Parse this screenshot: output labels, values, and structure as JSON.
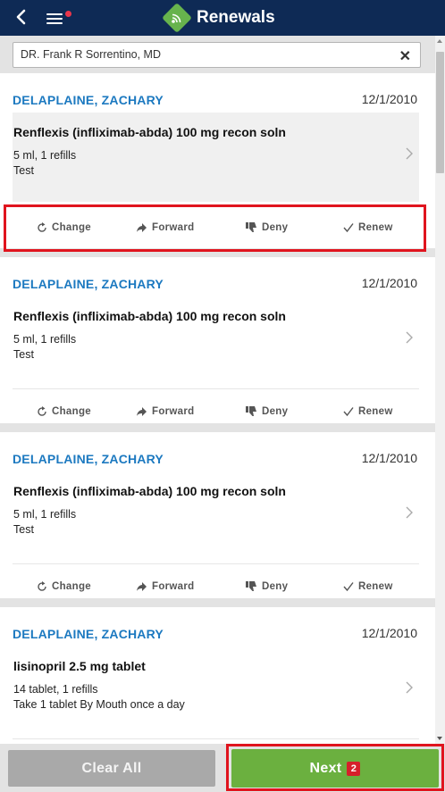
{
  "header": {
    "title": "Renewals",
    "menu_has_notification": true
  },
  "filter": {
    "value": "DR. Frank R Sorrentino, MD",
    "clear_glyph": "✕"
  },
  "actions": {
    "change": "Change",
    "forward": "Forward",
    "deny": "Deny",
    "renew": "Renew"
  },
  "cards": [
    {
      "patient": "DELAPLAINE, ZACHARY",
      "date": "12/1/2010",
      "drug": "Renflexis (infliximab-abda) 100 mg recon soln",
      "qty": "5 ml, 1 refills",
      "note": "Test",
      "selected": true
    },
    {
      "patient": "DELAPLAINE, ZACHARY",
      "date": "12/1/2010",
      "drug": "Renflexis (infliximab-abda) 100 mg recon soln",
      "qty": "5 ml, 1 refills",
      "note": "Test",
      "selected": false
    },
    {
      "patient": "DELAPLAINE, ZACHARY",
      "date": "12/1/2010",
      "drug": "Renflexis (infliximab-abda) 100 mg recon soln",
      "qty": "5 ml, 1 refills",
      "note": "Test",
      "selected": false
    },
    {
      "patient": "DELAPLAINE, ZACHARY",
      "date": "12/1/2010",
      "drug": "lisinopril 2.5 mg tablet",
      "qty": "14 tablet, 1 refills",
      "note": "Take 1 tablet By Mouth once a day",
      "selected": false
    }
  ],
  "footer": {
    "clear_all": "Clear All",
    "next": "Next",
    "next_count": "2"
  },
  "colors": {
    "header_bg": "#0e2a55",
    "accent_blue": "#1c79c0",
    "brand_green": "#67b34d",
    "next_green": "#6bb03f",
    "badge_red": "#d6202a",
    "highlight_red": "#e0141e"
  }
}
